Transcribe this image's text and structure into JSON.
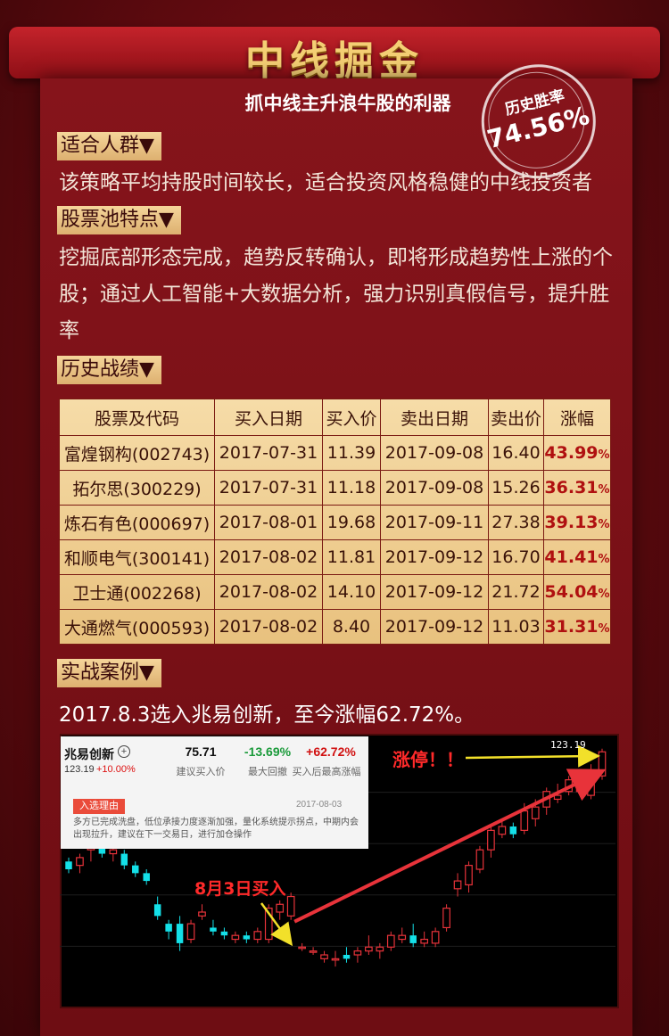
{
  "header": {
    "title": "中线掘金",
    "tagline": "抓中线主升浪牛股的利器"
  },
  "stamp": {
    "label": "历史胜率",
    "value": "74.56%"
  },
  "sections": {
    "audience": {
      "tag": "适合人群▼",
      "text": "该策略平均持股时间较长，适合投资风格稳健的中线投资者"
    },
    "pool": {
      "tag": "股票池特点▼",
      "text": "挖掘底部形态完成，趋势反转确认，即将形成趋势性上涨的个股；通过人工智能+大数据分析，强力识别真假信号，提升胜率"
    },
    "history": {
      "tag": "历史战绩▼"
    },
    "case": {
      "tag": "实战案例▼",
      "text": "2017.8.3选入兆易创新，至今涨幅62.72%。"
    }
  },
  "table": {
    "headers": [
      "股票及代码",
      "买入日期",
      "买入价",
      "卖出日期",
      "卖出价",
      "涨幅"
    ],
    "rows": [
      {
        "stock": "富煌钢构(002743)",
        "buy_date": "2017-07-31",
        "buy_price": "11.39",
        "sell_date": "2017-09-08",
        "sell_price": "16.40",
        "gain": "43.99",
        "unit": "%"
      },
      {
        "stock": "拓尔思(300229)",
        "buy_date": "2017-07-31",
        "buy_price": "11.18",
        "sell_date": "2017-09-08",
        "sell_price": "15.26",
        "gain": "36.31",
        "unit": "%"
      },
      {
        "stock": "炼石有色(000697)",
        "buy_date": "2017-08-01",
        "buy_price": "19.68",
        "sell_date": "2017-09-11",
        "sell_price": "27.38",
        "gain": "39.13",
        "unit": "%"
      },
      {
        "stock": "和顺电气(300141)",
        "buy_date": "2017-08-02",
        "buy_price": "11.81",
        "sell_date": "2017-09-12",
        "sell_price": "16.70",
        "gain": "41.41",
        "unit": "%"
      },
      {
        "stock": "卫士通(002268)",
        "buy_date": "2017-08-02",
        "buy_price": "14.10",
        "sell_date": "2017-09-12",
        "sell_price": "21.72",
        "gain": "54.04",
        "unit": "%"
      },
      {
        "stock": "大通燃气(000593)",
        "buy_date": "2017-08-02",
        "buy_price": "8.40",
        "sell_date": "2017-09-12",
        "sell_price": "11.03",
        "gain": "31.31",
        "unit": "%"
      }
    ]
  },
  "info_card": {
    "name": "兆易创新",
    "plus_icon": "+",
    "price": "123.19",
    "change": "+10.00%",
    "stats": [
      {
        "value": "75.71",
        "label": "建议买入价",
        "color": "#111111"
      },
      {
        "value": "-13.69%",
        "label": "最大回撤",
        "color": "#1a9a3a"
      },
      {
        "value": "+62.72%",
        "label": "买入后最高涨幅",
        "color": "#d11111"
      }
    ],
    "reason_tag": "入选理由",
    "date": "2017-08-03",
    "description": "多方已完成洗盘，低位承接力度逐渐加强，量化系统提示拐点，中期内会出现拉升，建议在下一交易日，进行加仓操作"
  },
  "annotations": {
    "buy_label": "8月3日买入",
    "limit_label": "涨停！！",
    "price_label": "123.19"
  },
  "colors": {
    "up": "#e8333a",
    "down": "#14e0e8",
    "arrow": "#e8333a",
    "pointer": "#f2e02a"
  },
  "chart_data": {
    "type": "candlestick",
    "up_color": "#e8333a",
    "down_color": "#14e0e8",
    "ylim": [
      60,
      126
    ],
    "candles": [
      {
        "o": 95,
        "h": 96,
        "l": 92,
        "c": 93
      },
      {
        "o": 94,
        "h": 97,
        "l": 92,
        "c": 96
      },
      {
        "o": 98,
        "h": 104,
        "l": 95,
        "c": 103
      },
      {
        "o": 101,
        "h": 103,
        "l": 96,
        "c": 97
      },
      {
        "o": 97,
        "h": 102,
        "l": 95,
        "c": 98
      },
      {
        "o": 97,
        "h": 98,
        "l": 93,
        "c": 94
      },
      {
        "o": 94,
        "h": 95,
        "l": 91,
        "c": 92
      },
      {
        "o": 92,
        "h": 93,
        "l": 89,
        "c": 90
      },
      {
        "o": 84,
        "h": 86,
        "l": 80,
        "c": 81
      },
      {
        "o": 79,
        "h": 80,
        "l": 75,
        "c": 77
      },
      {
        "o": 79,
        "h": 81,
        "l": 72,
        "c": 74
      },
      {
        "o": 75,
        "h": 80,
        "l": 74,
        "c": 79
      },
      {
        "o": 81,
        "h": 84,
        "l": 80,
        "c": 82
      },
      {
        "o": 78,
        "h": 80,
        "l": 76,
        "c": 77
      },
      {
        "o": 77,
        "h": 78,
        "l": 75,
        "c": 76
      },
      {
        "o": 75,
        "h": 77,
        "l": 74,
        "c": 76
      },
      {
        "o": 76,
        "h": 77,
        "l": 74,
        "c": 75
      },
      {
        "o": 75,
        "h": 78,
        "l": 74,
        "c": 77
      },
      {
        "o": 75,
        "h": 84,
        "l": 74,
        "c": 83
      },
      {
        "o": 82,
        "h": 85,
        "l": 80,
        "c": 84
      },
      {
        "o": 81,
        "h": 87,
        "l": 80,
        "c": 86
      },
      {
        "o": 73,
        "h": 74,
        "l": 72,
        "c": 73
      },
      {
        "o": 72,
        "h": 73,
        "l": 71,
        "c": 72
      },
      {
        "o": 70,
        "h": 72,
        "l": 69,
        "c": 71
      },
      {
        "o": 70,
        "h": 72,
        "l": 68,
        "c": 70
      },
      {
        "o": 71,
        "h": 73,
        "l": 69,
        "c": 70
      },
      {
        "o": 71,
        "h": 73,
        "l": 69,
        "c": 72
      },
      {
        "o": 72,
        "h": 76,
        "l": 71,
        "c": 73
      },
      {
        "o": 72,
        "h": 74,
        "l": 70,
        "c": 73
      },
      {
        "o": 73,
        "h": 77,
        "l": 72,
        "c": 76
      },
      {
        "o": 75,
        "h": 78,
        "l": 74,
        "c": 76
      },
      {
        "o": 76,
        "h": 79,
        "l": 73,
        "c": 74
      },
      {
        "o": 74,
        "h": 77,
        "l": 73,
        "c": 75
      },
      {
        "o": 74,
        "h": 78,
        "l": 73,
        "c": 77
      },
      {
        "o": 78,
        "h": 84,
        "l": 77,
        "c": 83
      },
      {
        "o": 88,
        "h": 92,
        "l": 86,
        "c": 90
      },
      {
        "o": 89,
        "h": 95,
        "l": 87,
        "c": 94
      },
      {
        "o": 93,
        "h": 99,
        "l": 92,
        "c": 98
      },
      {
        "o": 98,
        "h": 104,
        "l": 96,
        "c": 103
      },
      {
        "o": 102,
        "h": 106,
        "l": 101,
        "c": 104
      },
      {
        "o": 104,
        "h": 105,
        "l": 101,
        "c": 102
      },
      {
        "o": 103,
        "h": 110,
        "l": 102,
        "c": 108
      },
      {
        "o": 106,
        "h": 111,
        "l": 104,
        "c": 109
      },
      {
        "o": 109,
        "h": 114,
        "l": 107,
        "c": 113
      },
      {
        "o": 111,
        "h": 115,
        "l": 110,
        "c": 112
      },
      {
        "o": 113,
        "h": 117,
        "l": 112,
        "c": 116
      },
      {
        "o": 113,
        "h": 116,
        "l": 112,
        "c": 114
      },
      {
        "o": 112,
        "h": 120,
        "l": 111,
        "c": 118
      },
      {
        "o": 117,
        "h": 124,
        "l": 116,
        "c": 123.19
      }
    ]
  }
}
